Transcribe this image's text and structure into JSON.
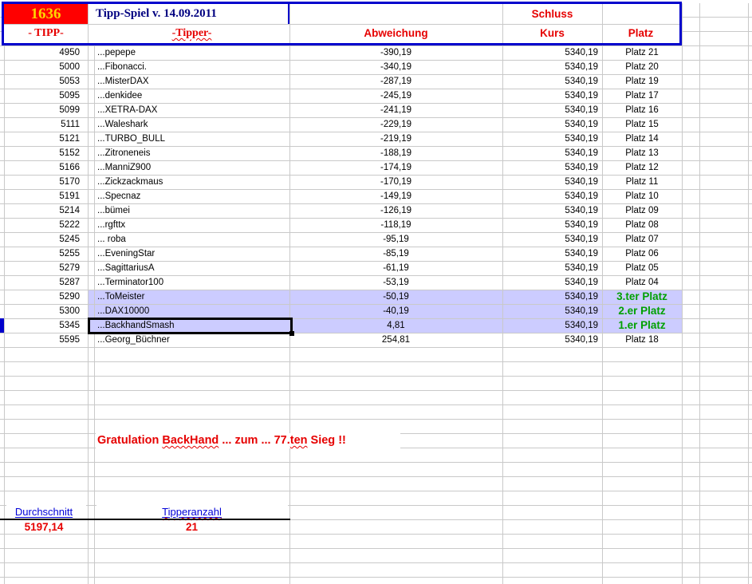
{
  "header": {
    "game_number": "1636",
    "title": "Tipp-Spiel v. 14.09.2011",
    "col_tipp": "- TIPP-",
    "col_tipper": "-Tipper-",
    "col_abweichung": "Abweichung",
    "col_schluss": "Schluss",
    "col_kurs": "Kurs",
    "col_platz": "Platz"
  },
  "rows": [
    {
      "tipp": "4950",
      "name": "...pepepe",
      "abw": "-390,19",
      "kurs": "5340,19",
      "platz": "Platz 21",
      "highlight": false,
      "green": false,
      "selected": false
    },
    {
      "tipp": "5000",
      "name": "...Fibonacci.",
      "abw": "-340,19",
      "kurs": "5340,19",
      "platz": "Platz 20",
      "highlight": false,
      "green": false,
      "selected": false
    },
    {
      "tipp": "5053",
      "name": "...MisterDAX",
      "abw": "-287,19",
      "kurs": "5340,19",
      "platz": "Platz 19",
      "highlight": false,
      "green": false,
      "selected": false
    },
    {
      "tipp": "5095",
      "name": "...denkidee",
      "abw": "-245,19",
      "kurs": "5340,19",
      "platz": "Platz 17",
      "highlight": false,
      "green": false,
      "selected": false
    },
    {
      "tipp": "5099",
      "name": "...XETRA-DAX",
      "abw": "-241,19",
      "kurs": "5340,19",
      "platz": "Platz 16",
      "highlight": false,
      "green": false,
      "selected": false
    },
    {
      "tipp": "5111",
      "name": "...Waleshark",
      "abw": "-229,19",
      "kurs": "5340,19",
      "platz": "Platz 15",
      "highlight": false,
      "green": false,
      "selected": false
    },
    {
      "tipp": "5121",
      "name": "...TURBO_BULL",
      "abw": "-219,19",
      "kurs": "5340,19",
      "platz": "Platz 14",
      "highlight": false,
      "green": false,
      "selected": false
    },
    {
      "tipp": "5152",
      "name": "...Zitroneneis",
      "abw": "-188,19",
      "kurs": "5340,19",
      "platz": "Platz 13",
      "highlight": false,
      "green": false,
      "selected": false
    },
    {
      "tipp": "5166",
      "name": "...ManniZ900",
      "abw": "-174,19",
      "kurs": "5340,19",
      "platz": "Platz 12",
      "highlight": false,
      "green": false,
      "selected": false
    },
    {
      "tipp": "5170",
      "name": "...Zickzackmaus",
      "abw": "-170,19",
      "kurs": "5340,19",
      "platz": "Platz 11",
      "highlight": false,
      "green": false,
      "selected": false
    },
    {
      "tipp": "5191",
      "name": "...Specnaz",
      "abw": "-149,19",
      "kurs": "5340,19",
      "platz": "Platz 10",
      "highlight": false,
      "green": false,
      "selected": false
    },
    {
      "tipp": "5214",
      "name": "...bümei",
      "abw": "-126,19",
      "kurs": "5340,19",
      "platz": "Platz 09",
      "highlight": false,
      "green": false,
      "selected": false
    },
    {
      "tipp": "5222",
      "name": "...rgfttx",
      "abw": "-118,19",
      "kurs": "5340,19",
      "platz": "Platz 08",
      "highlight": false,
      "green": false,
      "selected": false
    },
    {
      "tipp": "5245",
      "name": "... roba",
      "abw": "-95,19",
      "kurs": "5340,19",
      "platz": "Platz 07",
      "highlight": false,
      "green": false,
      "selected": false
    },
    {
      "tipp": "5255",
      "name": "...EveningStar",
      "abw": "-85,19",
      "kurs": "5340,19",
      "platz": "Platz 06",
      "highlight": false,
      "green": false,
      "selected": false
    },
    {
      "tipp": "5279",
      "name": "...SagittariusA",
      "abw": "-61,19",
      "kurs": "5340,19",
      "platz": "Platz 05",
      "highlight": false,
      "green": false,
      "selected": false
    },
    {
      "tipp": "5287",
      "name": "...Terminator100",
      "abw": "-53,19",
      "kurs": "5340,19",
      "platz": "Platz 04",
      "highlight": false,
      "green": false,
      "selected": false
    },
    {
      "tipp": "5290",
      "name": "...ToMeister",
      "abw": "-50,19",
      "kurs": "5340,19",
      "platz": "3.ter Platz",
      "highlight": true,
      "green": true,
      "selected": false
    },
    {
      "tipp": "5300",
      "name": "...DAX10000",
      "abw": "-40,19",
      "kurs": "5340,19",
      "platz": "2.er Platz",
      "highlight": true,
      "green": true,
      "selected": false
    },
    {
      "tipp": "5345",
      "name": "...BackhandSmash",
      "abw": "4,81",
      "kurs": "5340,19",
      "platz": "1.er Platz",
      "highlight": true,
      "green": true,
      "selected": true
    },
    {
      "tipp": "5595",
      "name": "...Georg_Büchner",
      "abw": "254,81",
      "kurs": "5340,19",
      "platz": "Platz 18",
      "highlight": false,
      "green": false,
      "selected": false
    }
  ],
  "message": {
    "part1": "Gratulation ",
    "misspelled1": "BackHand",
    "part2": " ... zum ... ",
    "num_prefix": "77.",
    "misspelled2": "ten",
    "part3": " Sieg !!"
  },
  "footer": {
    "durchschnitt_label": "Durchschnitt",
    "durchschnitt_value": "5197,14",
    "tipperanzahl_label": "Tipperanzahl",
    "tipperanzahl_value": "21"
  },
  "colors": {
    "highlight_lavender": "#CCCCFF",
    "accent_red_text": "#E60000",
    "game_number_bg": "#FF0000",
    "game_number_text": "#FFD400",
    "title_navy": "#000080",
    "header_box_blue": "#0000CC",
    "win_green": "#00A000",
    "footer_label_blue": "#0000D8",
    "gridline_gray": "#C9C9C9"
  }
}
